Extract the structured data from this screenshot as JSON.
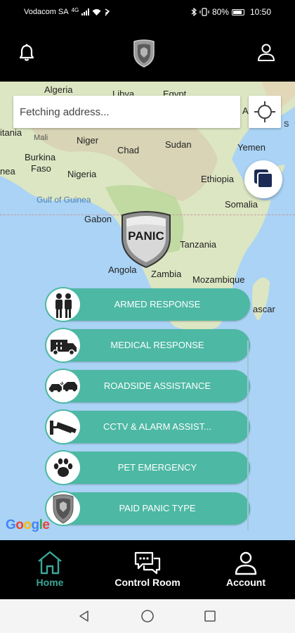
{
  "status_bar": {
    "carrier": "Vodacom SA",
    "network_type": "4G",
    "battery": "80%",
    "time": "10:50",
    "icons": [
      "signal-icon",
      "wifi-icon",
      "data-saver-icon",
      "bluetooth-icon",
      "vibrate-icon",
      "battery-icon"
    ]
  },
  "top_bar": {
    "icons": [
      "bell-icon",
      "shield-logo-icon",
      "user-icon"
    ]
  },
  "map": {
    "search_placeholder": "Fetching address...",
    "labels": {
      "algeria": "Algeria",
      "libya": "Libya",
      "egypt": "Egypt",
      "mauritania": "itania",
      "mali": "Mali",
      "niger": "Niger",
      "chad": "Chad",
      "sudan": "Sudan",
      "yemen": "Yemen",
      "burkina": "Burkina",
      "faso": "Faso",
      "guinea": "nea",
      "nigeria": "Nigeria",
      "ethiopia": "Ethiopia",
      "gulf": "Gulf of Guinea",
      "somalia": "Somalia",
      "gabon": "Gabon",
      "tanzania": "Tanzania",
      "angola": "Angola",
      "zambia": "Zambia",
      "mozambique": "Mozambique",
      "madagascar": "ascar",
      "edge_a": "A",
      "edge_right_top": "S"
    },
    "panic_label": "PANIC",
    "attribution": "Google"
  },
  "actions": [
    {
      "label": "ARMED RESPONSE",
      "icon": "guards-icon"
    },
    {
      "label": "MEDICAL RESPONSE",
      "icon": "ambulance-icon"
    },
    {
      "label": "ROADSIDE ASSISTANCE",
      "icon": "car-crash-icon"
    },
    {
      "label": "CCTV & ALARM ASSIST...",
      "icon": "cctv-camera-icon"
    },
    {
      "label": "PET EMERGENCY",
      "icon": "paw-icon"
    },
    {
      "label": "PAID PANIC TYPE",
      "icon": "shield-badge-icon"
    }
  ],
  "bottom_nav": [
    {
      "label": "Home",
      "icon": "home-icon",
      "active": true
    },
    {
      "label": "Control Room",
      "icon": "chat-bubbles-icon",
      "active": false
    },
    {
      "label": "Account",
      "icon": "account-icon",
      "active": false
    }
  ],
  "colors": {
    "accent": "#4db8a4",
    "active_nav": "#3aa797",
    "bars": "#000000",
    "water": "#aad3f5",
    "land": "#dfe6c4"
  }
}
